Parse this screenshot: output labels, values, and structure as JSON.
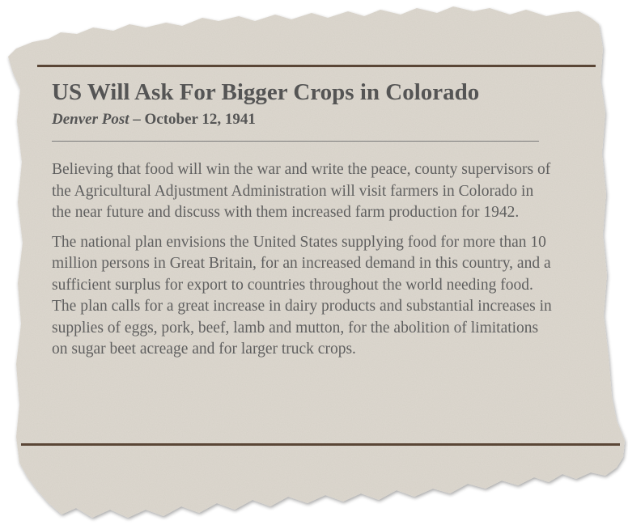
{
  "article": {
    "headline": "US Will Ask For Bigger Crops in Colorado",
    "source": "Denver Post",
    "dash": " – ",
    "date": "October 12, 1941",
    "paragraphs": [
      "Believing that food will win the war and write the peace, county supervisors of the Agricultural Adjustment Administration will visit farmers in Colorado in the near future and discuss with them increased farm production for 1942.",
      "The national plan envisions the United States supplying food for more than 10 million persons in Great Britain, for an increased demand in this country, and a sufficient surplus for export to countries throughout the world needing food. The plan calls for a great increase in dairy products and substantial increases in supplies of eggs, pork, beef, lamb and mutton, for the abolition of limitations on sugar beet acreage and for larger truck crops."
    ]
  },
  "colors": {
    "paper": "#ddd8cf",
    "rule": "#5a4636",
    "text": "#5f5f5f"
  }
}
